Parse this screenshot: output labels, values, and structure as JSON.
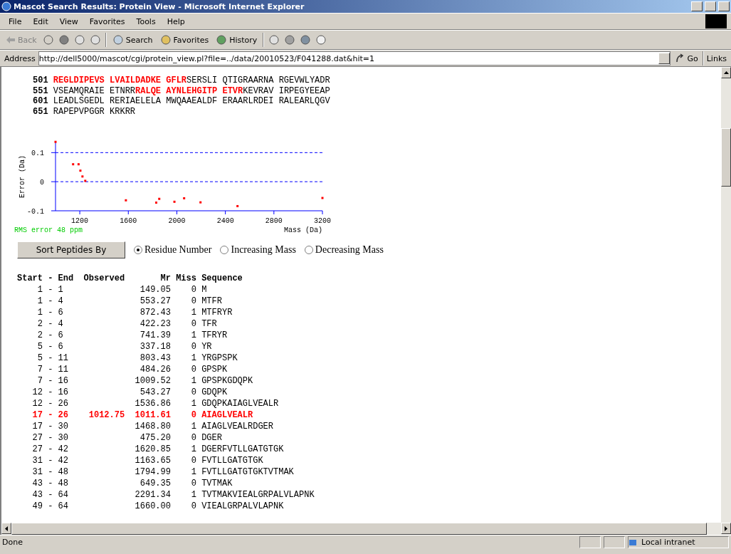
{
  "window": {
    "title": "Mascot Search Results: Protein View - Microsoft Internet Explorer"
  },
  "menu": [
    "File",
    "Edit",
    "View",
    "Favorites",
    "Tools",
    "Help"
  ],
  "toolbar": {
    "back": "Back",
    "search": "Search",
    "favorites": "Favorites",
    "history": "History"
  },
  "address": {
    "label": "Address",
    "url": "http://dell5000/mascot/cgi/protein_view.pl?file=../data/20010523/F041288.dat&hit=1",
    "go": "Go",
    "links": "Links"
  },
  "sequence": [
    {
      "number": "501",
      "segments": [
        {
          "text": "REGLDIPEVS LVAILDADKE GFLR",
          "matched": true
        },
        {
          "text": "SERSLI QTIGRAARNA RGEVWLYADR",
          "matched": false
        }
      ]
    },
    {
      "number": "551",
      "segments": [
        {
          "text": "VSEAMQRAIE ETNRR",
          "matched": false
        },
        {
          "text": "RALQE AYNLEHGITP ETVR",
          "matched": true
        },
        {
          "text": "KEVRAV IRPEGYEEAP",
          "matched": false
        }
      ]
    },
    {
      "number": "601",
      "segments": [
        {
          "text": "LEADLSGEDL RERIAELELA MWQAAEALDF ERAARLRDEI RALEARLQGV",
          "matched": false
        }
      ]
    },
    {
      "number": "651",
      "segments": [
        {
          "text": "RAPEPVPGGR KRKRR",
          "matched": false
        }
      ]
    }
  ],
  "error_plot": {
    "rms": "RMS error 48 ppm",
    "chart_data": {
      "type": "scatter",
      "xlabel": "Mass (Da)",
      "ylabel": "Error (Da)",
      "x": [
        1000,
        1145,
        1190,
        1205,
        1222,
        1245,
        1580,
        1830,
        1855,
        1980,
        2060,
        2195,
        2500,
        3200
      ],
      "series": [
        {
          "color": "#ff0000",
          "values": [
            0.137,
            0.06,
            0.06,
            0.038,
            0.018,
            0.003,
            -0.064,
            -0.072,
            -0.059,
            -0.069,
            -0.057,
            -0.071,
            -0.084,
            -0.056
          ]
        }
      ],
      "xlim": [
        1000,
        3200
      ],
      "ylim": [
        -0.1,
        0.14
      ],
      "xticks": [
        1200,
        1600,
        2000,
        2400,
        2800,
        3200
      ],
      "yticks": [
        {
          "value": 0.1,
          "label": "0.1"
        },
        {
          "value": 0,
          "label": "0"
        },
        {
          "value": -0.1,
          "label": "-0.1"
        }
      ]
    }
  },
  "sort": {
    "button": "Sort Peptides By",
    "options": [
      {
        "label": "Residue Number",
        "selected": true
      },
      {
        "label": "Increasing Mass",
        "selected": false
      },
      {
        "label": "Decreasing Mass",
        "selected": false
      }
    ]
  },
  "peptides": {
    "columns": [
      "Start",
      "-",
      "End",
      "Observed",
      "Mr",
      "Miss",
      "Sequence"
    ],
    "rows": [
      {
        "start": "1",
        "end": "1",
        "observed": "",
        "mr": "149.05",
        "miss": "0",
        "sequence": "M",
        "matched": false
      },
      {
        "start": "1",
        "end": "4",
        "observed": "",
        "mr": "553.27",
        "miss": "0",
        "sequence": "MTFR",
        "matched": false
      },
      {
        "start": "1",
        "end": "6",
        "observed": "",
        "mr": "872.43",
        "miss": "1",
        "sequence": "MTFRYR",
        "matched": false
      },
      {
        "start": "2",
        "end": "4",
        "observed": "",
        "mr": "422.23",
        "miss": "0",
        "sequence": "TFR",
        "matched": false
      },
      {
        "start": "2",
        "end": "6",
        "observed": "",
        "mr": "741.39",
        "miss": "1",
        "sequence": "TFRYR",
        "matched": false
      },
      {
        "start": "5",
        "end": "6",
        "observed": "",
        "mr": "337.18",
        "miss": "0",
        "sequence": "YR",
        "matched": false
      },
      {
        "start": "5",
        "end": "11",
        "observed": "",
        "mr": "803.43",
        "miss": "1",
        "sequence": "YRGPSPK",
        "matched": false
      },
      {
        "start": "7",
        "end": "11",
        "observed": "",
        "mr": "484.26",
        "miss": "0",
        "sequence": "GPSPK",
        "matched": false
      },
      {
        "start": "7",
        "end": "16",
        "observed": "",
        "mr": "1009.52",
        "miss": "1",
        "sequence": "GPSPKGDQPK",
        "matched": false
      },
      {
        "start": "12",
        "end": "16",
        "observed": "",
        "mr": "543.27",
        "miss": "0",
        "sequence": "GDQPK",
        "matched": false
      },
      {
        "start": "12",
        "end": "26",
        "observed": "",
        "mr": "1536.86",
        "miss": "1",
        "sequence": "GDQPKAIAGLVEALR",
        "matched": false
      },
      {
        "start": "17",
        "end": "26",
        "observed": "1012.75",
        "mr": "1011.61",
        "miss": "0",
        "sequence": "AIAGLVEALR",
        "matched": true
      },
      {
        "start": "17",
        "end": "30",
        "observed": "",
        "mr": "1468.80",
        "miss": "1",
        "sequence": "AIAGLVEALRDGER",
        "matched": false
      },
      {
        "start": "27",
        "end": "30",
        "observed": "",
        "mr": "475.20",
        "miss": "0",
        "sequence": "DGER",
        "matched": false
      },
      {
        "start": "27",
        "end": "42",
        "observed": "",
        "mr": "1620.85",
        "miss": "1",
        "sequence": "DGERFVTLLGATGTGK",
        "matched": false
      },
      {
        "start": "31",
        "end": "42",
        "observed": "",
        "mr": "1163.65",
        "miss": "0",
        "sequence": "FVTLLGATGTGK",
        "matched": false
      },
      {
        "start": "31",
        "end": "48",
        "observed": "",
        "mr": "1794.99",
        "miss": "1",
        "sequence": "FVTLLGATGTGKTVTMAK",
        "matched": false
      },
      {
        "start": "43",
        "end": "48",
        "observed": "",
        "mr": "649.35",
        "miss": "0",
        "sequence": "TVTMAK",
        "matched": false
      },
      {
        "start": "43",
        "end": "64",
        "observed": "",
        "mr": "2291.34",
        "miss": "1",
        "sequence": "TVTMAKVIEALGRPALVLAPNK",
        "matched": false
      },
      {
        "start": "49",
        "end": "64",
        "observed": "",
        "mr": "1660.00",
        "miss": "0",
        "sequence": "VIEALGRPALVLAPNK",
        "matched": false
      }
    ]
  },
  "status_bar": {
    "text": "Done",
    "zone": "Local intranet"
  }
}
